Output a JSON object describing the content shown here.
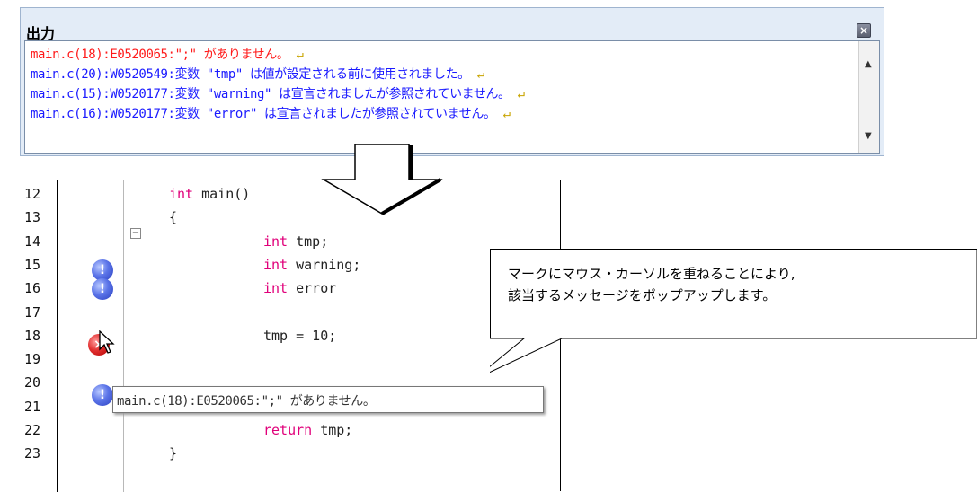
{
  "output_panel": {
    "title": "出力",
    "close_icon": "close-icon",
    "lines": [
      {
        "text": "main.c(18):E0520065:\";\" がありません。",
        "kind": "error"
      },
      {
        "text": "main.c(20):W0520549:変数 \"tmp\" は値が設定される前に使用されました。",
        "kind": "warning"
      },
      {
        "text": "main.c(15):W0520177:変数 \"warning\" は宣言されましたが参照されていません。",
        "kind": "warning"
      },
      {
        "text": "main.c(16):W0520177:変数 \"error\" は宣言されましたが参照されていません。",
        "kind": "warning"
      }
    ],
    "eol_marker": "↵",
    "scroll_up_icon": "▲",
    "scroll_down_icon": "▼"
  },
  "editor": {
    "lines": [
      {
        "num": "12",
        "pre": "",
        "kw": "int",
        "post": " main()"
      },
      {
        "num": "13",
        "pre": "",
        "kw": "",
        "post": "{"
      },
      {
        "num": "14",
        "pre": "",
        "kw": "int",
        "post": " tmp;"
      },
      {
        "num": "15",
        "pre": "",
        "kw": "int",
        "post": " warning;"
      },
      {
        "num": "16",
        "pre": "",
        "kw": "int",
        "post": " error"
      },
      {
        "num": "17",
        "pre": "",
        "kw": "",
        "post": ""
      },
      {
        "num": "18",
        "pre": "",
        "kw": "",
        "post": "tmp = 10;"
      },
      {
        "num": "19",
        "pre": "",
        "kw": "",
        "post": ""
      },
      {
        "num": "20",
        "pre": "",
        "kw": "",
        "post": ""
      },
      {
        "num": "21",
        "pre": "",
        "kw": "",
        "post": ""
      },
      {
        "num": "22",
        "pre": "",
        "kw": "return",
        "post": " tmp;"
      },
      {
        "num": "23",
        "pre": "",
        "kw": "",
        "post": "}"
      }
    ],
    "fold_glyph": "−",
    "info_glyph": "!",
    "error_glyph": "×",
    "tooltip": "main.c(18):E0520065:\";\" がありません。"
  },
  "callout": {
    "line1": "マークにマウス・カーソルを重ねることにより,",
    "line2": "該当するメッセージをポップアップします。"
  },
  "colors": {
    "error_text": "#ff1a1a",
    "warning_text": "#1a1aff",
    "panel_bg": "#e3ecf7",
    "keyword": "#e0007a"
  }
}
